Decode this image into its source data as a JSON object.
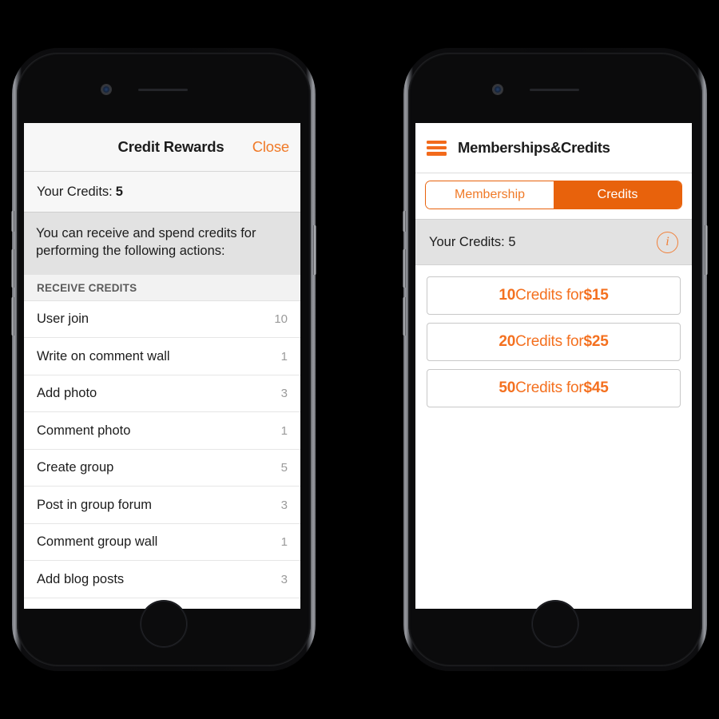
{
  "left_phone": {
    "device_name": "smartphone-frame",
    "screen": {
      "modal": {
        "title": "Credit Rewards",
        "close_label": "Close",
        "credits_label": "Your Credits:",
        "credits_value": "5",
        "description": "You can receive and spend credits for performing the following actions:",
        "section_header": "RECEIVE CREDITS",
        "items": [
          {
            "label": "User join",
            "value": "10"
          },
          {
            "label": "Write on comment wall",
            "value": "1"
          },
          {
            "label": "Add photo",
            "value": "3"
          },
          {
            "label": "Comment photo",
            "value": "1"
          },
          {
            "label": "Create group",
            "value": "5"
          },
          {
            "label": "Post in group forum",
            "value": "3"
          },
          {
            "label": "Comment group wall",
            "value": "1"
          },
          {
            "label": "Add blog posts",
            "value": "3"
          }
        ]
      }
    }
  },
  "right_phone": {
    "device_name": "smartphone-frame",
    "screen": {
      "header": {
        "menu_icon": "hamburger-menu-icon",
        "title": "Memberships&Credits"
      },
      "tabs": [
        {
          "label": "Membership",
          "active": false
        },
        {
          "label": "Credits",
          "active": true
        }
      ],
      "balance": {
        "label": "Your Credits: 5",
        "info_icon": "info-icon",
        "info_glyph": "i"
      },
      "offers": [
        {
          "amount": "10",
          "suffix": " Credits for ",
          "price": "$15"
        },
        {
          "amount": "20",
          "suffix": " Credits for ",
          "price": "$25"
        },
        {
          "amount": "50",
          "suffix": " Credits for ",
          "price": "$45"
        }
      ]
    }
  },
  "colors": {
    "accent_orange": "#f26a1b",
    "accent_orange_dark": "#e8620c",
    "accent_orange_light": "#f07a28",
    "background": "#000000",
    "screen_white": "#ffffff",
    "gray_block": "#e2e2e2"
  }
}
